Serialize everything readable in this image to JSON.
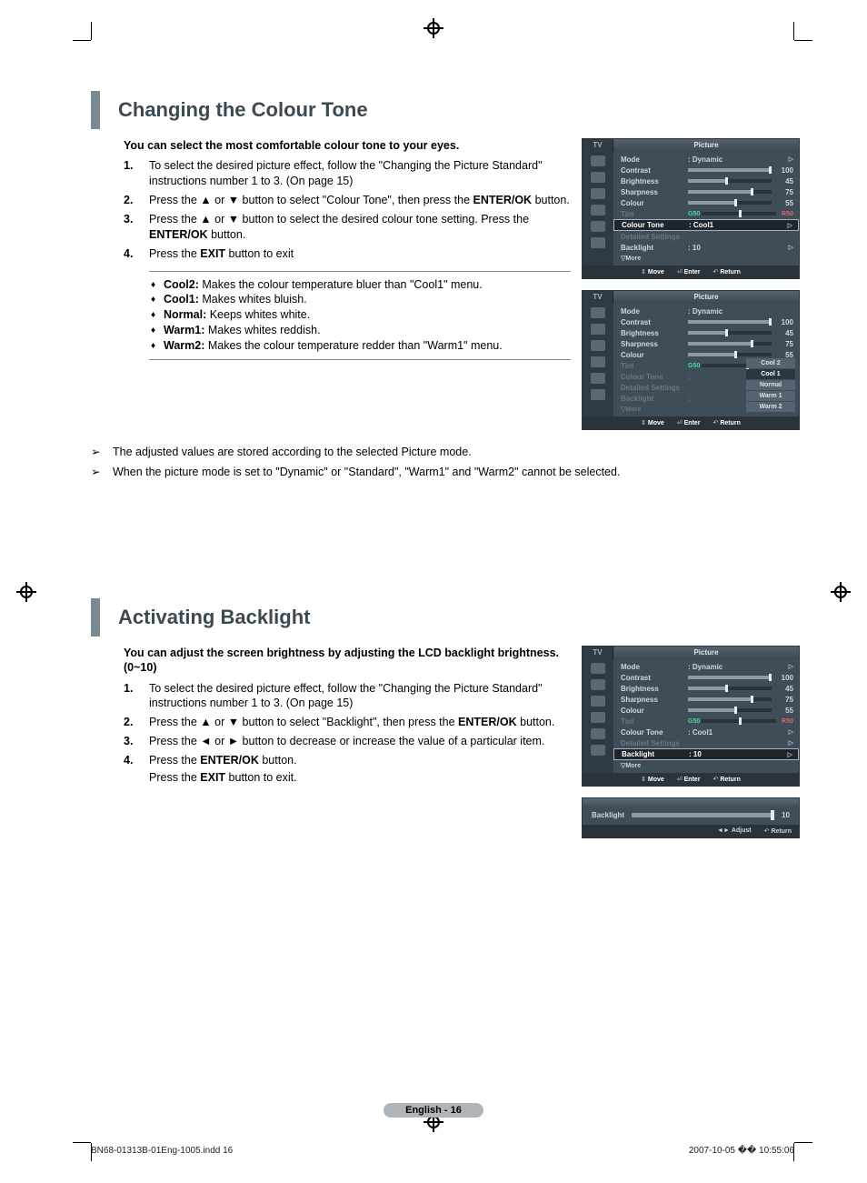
{
  "section1": {
    "title": "Changing the Colour Tone",
    "intro": "You can select the most comfortable colour tone to your eyes.",
    "steps": [
      "To select the desired picture effect, follow the \"Changing the Picture Standard\" instructions number 1 to 3. (On page 15)",
      "Press the ▲ or ▼ button to select \"Colour Tone\", then press the ENTER/OK button.",
      "Press the ▲ or ▼ button to select the desired colour tone setting. Press the ENTER/OK button.",
      "Press the EXIT button to exit"
    ],
    "options": [
      {
        "term": "Cool2:",
        "desc": "Makes the colour temperature bluer than \"Cool1\" menu."
      },
      {
        "term": "Cool1:",
        "desc": "Makes whites bluish."
      },
      {
        "term": "Normal:",
        "desc": "Keeps whites white."
      },
      {
        "term": "Warm1:",
        "desc": "Makes whites reddish."
      },
      {
        "term": "Warm2:",
        "desc": "Makes the colour temperature redder than \"Warm1\" menu."
      }
    ],
    "notes": [
      "The adjusted values are stored according to the selected Picture mode.",
      "When the picture mode is set to \"Dynamic\" or \"Standard\", \"Warm1\" and \"Warm2\" cannot be selected."
    ]
  },
  "section2": {
    "title": "Activating Backlight",
    "intro": "You can adjust the screen brightness by adjusting the LCD backlight brightness. (0~10)",
    "steps": [
      "To select the desired picture effect, follow the \"Changing the Picture Standard\" instructions number 1 to 3. (On page 15)",
      "Press the ▲ or ▼ button to select \"Backlight\", then press the ENTER/OK button.",
      "Press the ◄ or ► button to decrease or increase the value of a particular item.",
      "Press the ENTER/OK button."
    ],
    "tail": "Press the EXIT button to exit."
  },
  "osd": {
    "tv": "TV",
    "title": "Picture",
    "rows": {
      "mode": "Mode",
      "mode_val": ": Dynamic",
      "contrast": "Contrast",
      "contrast_val": "100",
      "brightness": "Brightness",
      "brightness_val": "45",
      "sharpness": "Sharpness",
      "sharpness_val": "75",
      "colour": "Colour",
      "colour_val": "55",
      "tint": "Tint",
      "tint_g": "G50",
      "tint_r": "R50",
      "colour_tone": "Colour Tone",
      "colour_tone_val": ": Cool1",
      "detailed": "Detailed Settings",
      "backlight": "Backlight",
      "backlight_val": ": 10",
      "more": "▽More"
    },
    "footer": {
      "move": "Move",
      "enter": "Enter",
      "return": "Return",
      "adjust": "Adjust"
    },
    "tone_opts": [
      "Cool 2",
      "Cool 1",
      "Normal",
      "Warm 1",
      "Warm 2"
    ]
  },
  "adjbar": {
    "label": "Backlight",
    "value": "10"
  },
  "pageNum": "English - 16",
  "footerLeft": "BN68-01313B-01Eng-1005.indd   16",
  "footerRight": "2007-10-05   �� 10:55:06"
}
